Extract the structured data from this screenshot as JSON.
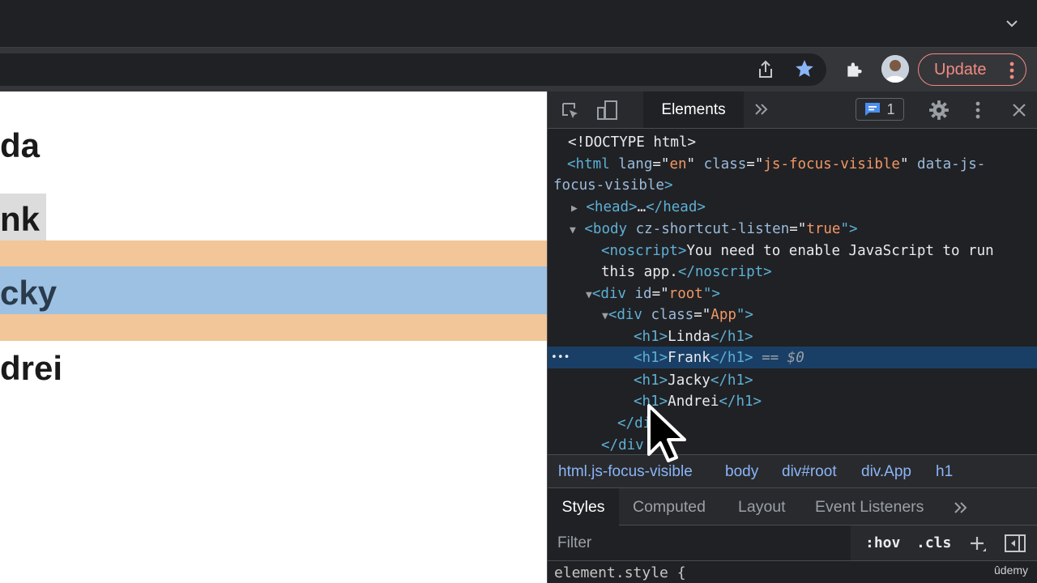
{
  "toolbar": {
    "update_label": "Update"
  },
  "page": {
    "headings": [
      "da",
      "nk",
      "cky",
      "drei"
    ]
  },
  "devtools": {
    "tab_elements": "Elements",
    "issues_count": "1",
    "dom": {
      "l0": "<!DOCTYPE html>",
      "l1a": "<html ",
      "l1b": "lang",
      "l1c": "=\"",
      "l1d": "en",
      "l1e": "\" ",
      "l1f": "class",
      "l1g": "=\"",
      "l1h": "js-focus-visible",
      "l1i": "\" ",
      "l1j": "data-js-",
      "l2a": "focus-visible",
      "l2b": ">",
      "l3a": "<head>",
      "l3b": "…",
      "l3c": "</head>",
      "l4a": "<body ",
      "l4b": "cz-shortcut-listen",
      "l4c": "=\"",
      "l4d": "true",
      "l4e": "\">",
      "l5a": "<noscript>",
      "l5b": "You need to enable JavaScript to run",
      "l6a": "this app.",
      "l6b": "</noscript>",
      "l7a": "<div ",
      "l7b": "id",
      "l7c": "=\"",
      "l7d": "root",
      "l7e": "\">",
      "l8a": "<div ",
      "l8b": "class",
      "l8c": "=\"",
      "l8d": "App",
      "l8e": "\">",
      "h1_open": "<h1>",
      "h1_close": "</h1>",
      "linda": "Linda",
      "frank": "Frank",
      "jacky": "Jacky",
      "andrei": "Andrei",
      "selected_marker": "== $0",
      "ellipsis": "•••",
      "l13": "</di",
      "l14": "</div"
    },
    "breadcrumbs": [
      "html.js-focus-visible",
      "body",
      "div#root",
      "div.App",
      "h1"
    ],
    "sub_tabs": [
      "Styles",
      "Computed",
      "Layout",
      "Event Listeners"
    ],
    "filter_placeholder": "Filter",
    "filter_hov": ":hov",
    "filter_cls": ".cls",
    "element_style": "element.style {"
  },
  "watermark": "ûdemy"
}
